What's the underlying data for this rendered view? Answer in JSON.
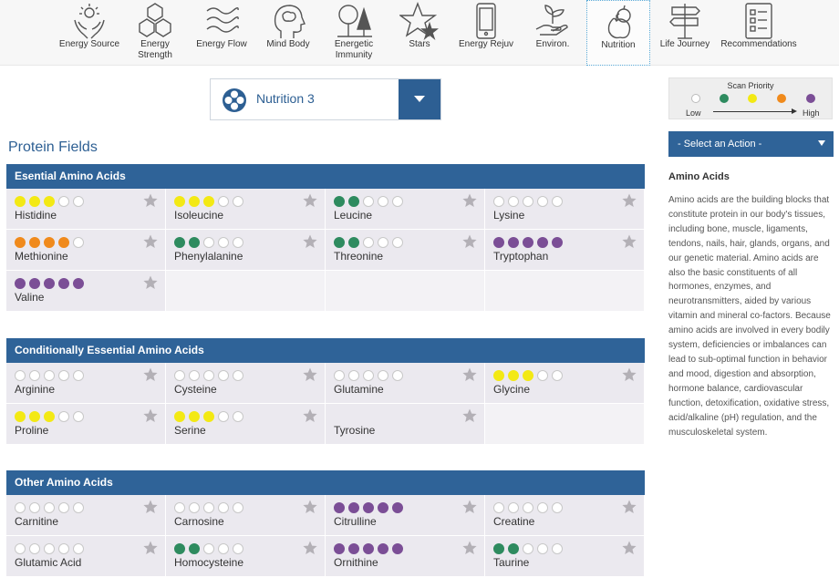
{
  "nav": {
    "items": [
      {
        "label": "Energy Source",
        "icon": "hands-sun-icon"
      },
      {
        "label": "Energy\nStrength",
        "icon": "hexagons-icon"
      },
      {
        "label": "Energy Flow",
        "icon": "waves-icon"
      },
      {
        "label": "Mind Body",
        "icon": "head-brain-icon"
      },
      {
        "label": "Energetic\nImmunity",
        "icon": "trees-icon"
      },
      {
        "label": "Stars",
        "icon": "stars-icon"
      },
      {
        "label": "Energy Rejuv",
        "icon": "phone-icon"
      },
      {
        "label": "Environ.",
        "icon": "hand-plant-icon"
      },
      {
        "label": "Nutrition",
        "icon": "fruit-icon"
      },
      {
        "label": "Life Journey",
        "icon": "signpost-icon"
      },
      {
        "label": "Recommendations",
        "icon": "checklist-icon"
      }
    ],
    "active_index": 8
  },
  "selector": {
    "label": "Nutrition 3"
  },
  "page_title": "Protein Fields",
  "colors": {
    "header_blue": "#2f6398",
    "yellow": "#f3e914",
    "green": "#2e8b5f",
    "orange": "#f08a1c",
    "purple": "#7b4e96"
  },
  "sections": [
    {
      "title": "Esential Amino Acids",
      "cells": [
        {
          "name": "Histidine",
          "level": 3,
          "color": "yellow"
        },
        {
          "name": "Isoleucine",
          "level": 3,
          "color": "yellow"
        },
        {
          "name": "Leucine",
          "level": 2,
          "color": "green"
        },
        {
          "name": "Lysine",
          "level": 0,
          "color": "none"
        },
        {
          "name": "Methionine",
          "level": 4,
          "color": "orange"
        },
        {
          "name": "Phenylalanine",
          "level": 2,
          "color": "green"
        },
        {
          "name": "Threonine",
          "level": 2,
          "color": "green"
        },
        {
          "name": "Tryptophan",
          "level": 5,
          "color": "purple"
        },
        {
          "name": "Valine",
          "level": 5,
          "color": "purple"
        }
      ]
    },
    {
      "title": "Conditionally Essential Amino Acids",
      "cells": [
        {
          "name": "Arginine",
          "level": 0,
          "color": "none"
        },
        {
          "name": "Cysteine",
          "level": 0,
          "color": "none"
        },
        {
          "name": "Glutamine",
          "level": 0,
          "color": "none"
        },
        {
          "name": "Glycine",
          "level": 3,
          "color": "yellow"
        },
        {
          "name": "Proline",
          "level": 3,
          "color": "yellow"
        },
        {
          "name": "Serine",
          "level": 3,
          "color": "yellow"
        },
        {
          "name": "Tyrosine",
          "level": 0,
          "color": "none",
          "no_dots": true
        }
      ]
    },
    {
      "title": "Other Amino Acids",
      "cells": [
        {
          "name": "Carnitine",
          "level": 0,
          "color": "none"
        },
        {
          "name": "Carnosine",
          "level": 0,
          "color": "none"
        },
        {
          "name": "Citrulline",
          "level": 5,
          "color": "purple"
        },
        {
          "name": "Creatine",
          "level": 0,
          "color": "none"
        },
        {
          "name": "Glutamic Acid",
          "level": 0,
          "color": "none"
        },
        {
          "name": "Homocysteine",
          "level": 2,
          "color": "green"
        },
        {
          "name": "Ornithine",
          "level": 5,
          "color": "purple"
        },
        {
          "name": "Taurine",
          "level": 2,
          "color": "green"
        }
      ]
    }
  ],
  "legend": {
    "title": "Scan Priority",
    "low": "Low",
    "high": "High"
  },
  "action": {
    "label": "- Select an Action -"
  },
  "info": {
    "title": "Amino Acids",
    "text": "Amino acids are the building blocks that constitute protein in our body's tissues, including bone, muscle, ligaments, tendons, nails, hair, glands, organs, and our genetic material. Amino acids are also the basic constituents of all hormones, enzymes, and neurotransmitters, aided by various vitamin and mineral co-factors. Because amino acids are involved in every bodily system, deficiencies or imbalances can lead to sub-optimal function in behavior and mood, digestion and absorption, hormone balance, cardiovascular function, detoxification, oxidative stress, acid/alkaline (pH) regulation, and the musculoskeletal system."
  }
}
